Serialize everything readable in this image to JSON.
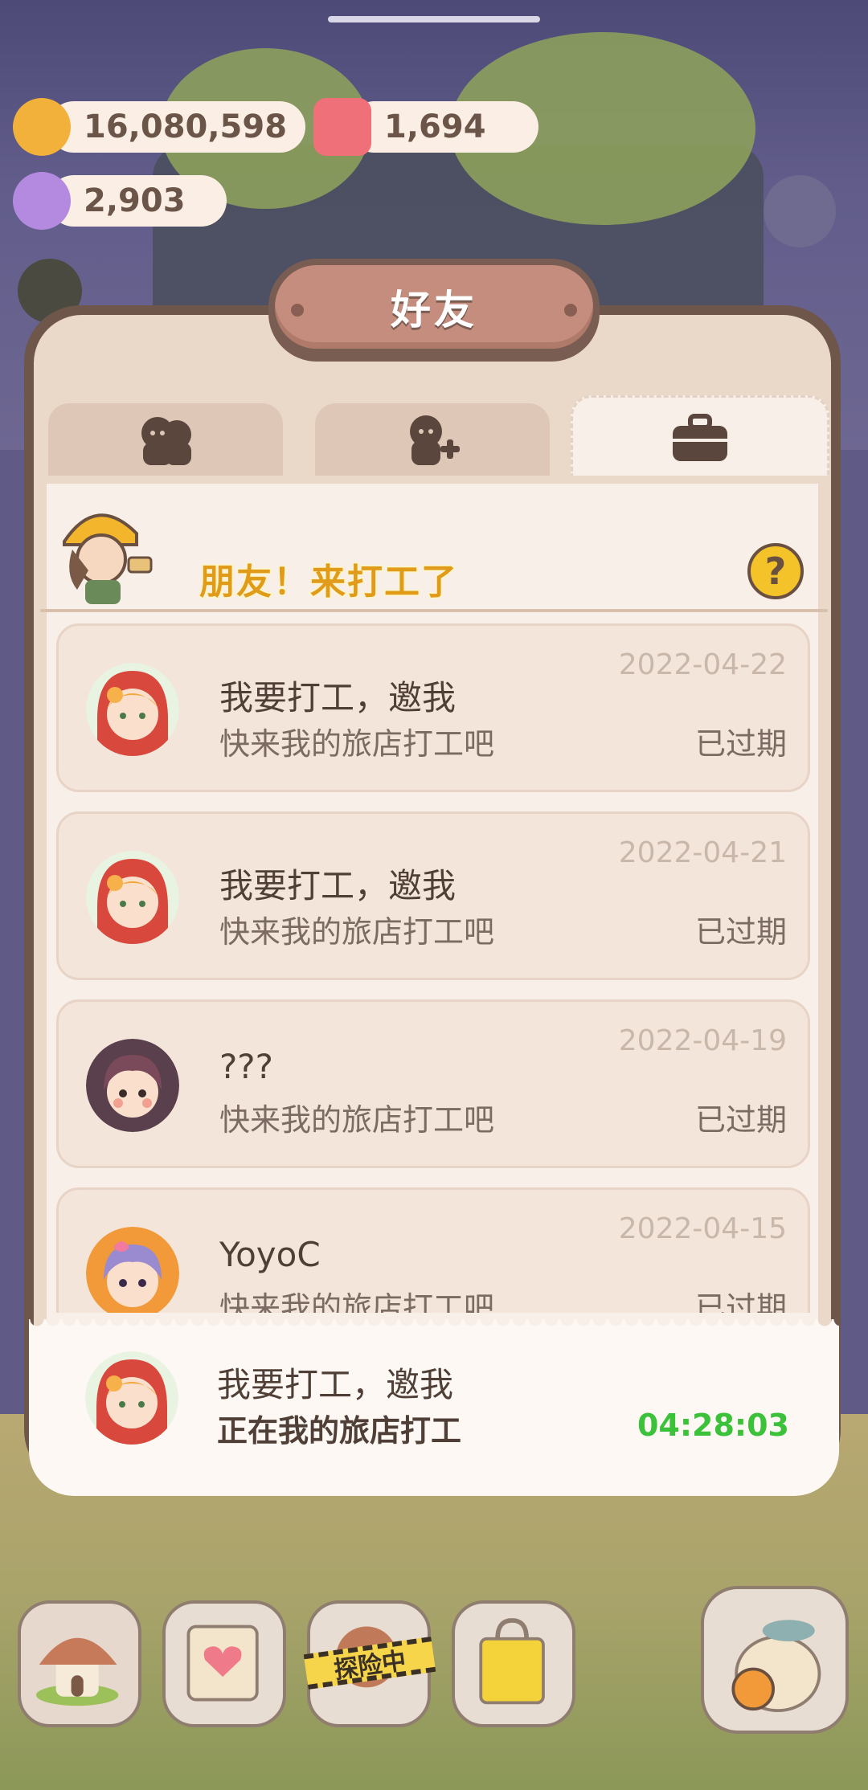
{
  "currencies": [
    {
      "name": "cookie",
      "value": "16,080,598",
      "color": "#f2b13b"
    },
    {
      "name": "candle",
      "value": "1,694",
      "color": "#f0707a"
    },
    {
      "name": "crystal",
      "value": "2,903",
      "color": "#b48ae0"
    }
  ],
  "dialog": {
    "title": "好友",
    "tabs": [
      {
        "icon": "friends-icon",
        "active": false
      },
      {
        "icon": "add-friend-icon",
        "active": false
      },
      {
        "icon": "briefcase-icon",
        "active": true
      }
    ],
    "banner_text": "朋友！来打工了",
    "help_label": "?"
  },
  "list": [
    {
      "name": "我要打工，邀我",
      "message": "快来我的旅店打工吧",
      "date": "2022-04-22",
      "status": "已过期",
      "avatar": "red-hood-avatar"
    },
    {
      "name": "我要打工，邀我",
      "message": "快来我的旅店打工吧",
      "date": "2022-04-21",
      "status": "已过期",
      "avatar": "red-hood-avatar"
    },
    {
      "name": "???",
      "message": "快来我的旅店打工吧",
      "date": "2022-04-19",
      "status": "已过期",
      "avatar": "brown-hair-avatar"
    },
    {
      "name": "YoyoC",
      "message": "快来我的旅店打工吧",
      "date": "2022-04-15",
      "status": "已过期",
      "avatar": "purple-hair-avatar"
    }
  ],
  "current": {
    "name": "我要打工，邀我",
    "message": "正在我的旅店打工",
    "timer": "04:28:03",
    "avatar": "red-hood-avatar"
  },
  "bottom_nav": {
    "explore_tape": "探险中"
  }
}
